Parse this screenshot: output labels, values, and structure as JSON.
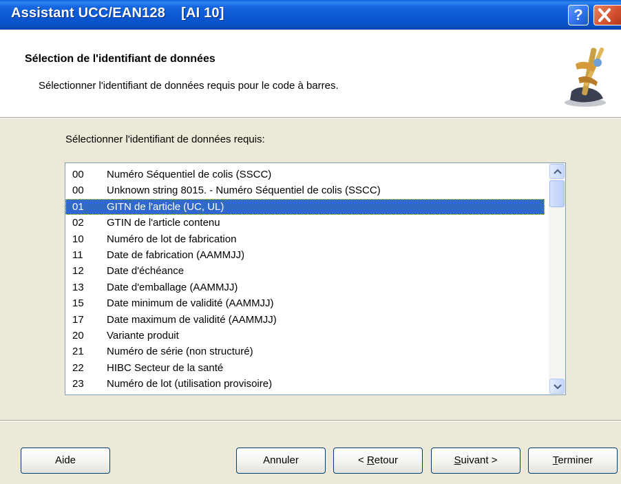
{
  "window": {
    "title": "Assistant UCC/EAN128    [AI 10]",
    "help_button": "?"
  },
  "header": {
    "title": "Sélection de l'identifiant de données",
    "subtitle": "Sélectionner l'identifiant de données requis pour le code à barres."
  },
  "list": {
    "label": "Sélectionner l'identifiant de données requis:",
    "selected_index": 2,
    "items": [
      {
        "code": "00",
        "desc": "Numéro Séquentiel de colis (SSCC)"
      },
      {
        "code": "00",
        "desc": "Unknown string 8015. - Numéro Séquentiel de colis (SSCC)"
      },
      {
        "code": "01",
        "desc": "GITN de l'article (UC, UL)"
      },
      {
        "code": "02",
        "desc": "GTIN de l'article contenu"
      },
      {
        "code": "10",
        "desc": "Numéro de lot de fabrication"
      },
      {
        "code": "11",
        "desc": "Date de fabrication (AAMMJJ)"
      },
      {
        "code": "12",
        "desc": "Date d'échéance"
      },
      {
        "code": "13",
        "desc": "Date d'emballage (AAMMJJ)"
      },
      {
        "code": "15",
        "desc": "Date minimum de validité (AAMMJJ)"
      },
      {
        "code": "17",
        "desc": "Date maximum de validité (AAMMJJ)"
      },
      {
        "code": "20",
        "desc": "Variante produit"
      },
      {
        "code": "21",
        "desc": "Numéro de série (non structuré)"
      },
      {
        "code": "22",
        "desc": "HIBC Secteur de la santé"
      },
      {
        "code": "23",
        "desc": "Numéro de lot (utilisation provisoire)"
      }
    ]
  },
  "buttons": {
    "aide": "Aide",
    "annuler": "Annuler",
    "retour_prefix": "< ",
    "retour_key": "R",
    "retour_rest": "etour",
    "suivant_key": "S",
    "suivant_rest": "uivant >",
    "terminer_key": "T",
    "terminer_rest": "erminer"
  },
  "colors": {
    "selection": "#316AC5",
    "titlebar": "#0A50C6",
    "dialog_bg": "#ECE9D8"
  },
  "icons": [
    "help-icon",
    "close-icon",
    "wizard-icon",
    "scroll-up-icon",
    "scroll-down-icon"
  ]
}
